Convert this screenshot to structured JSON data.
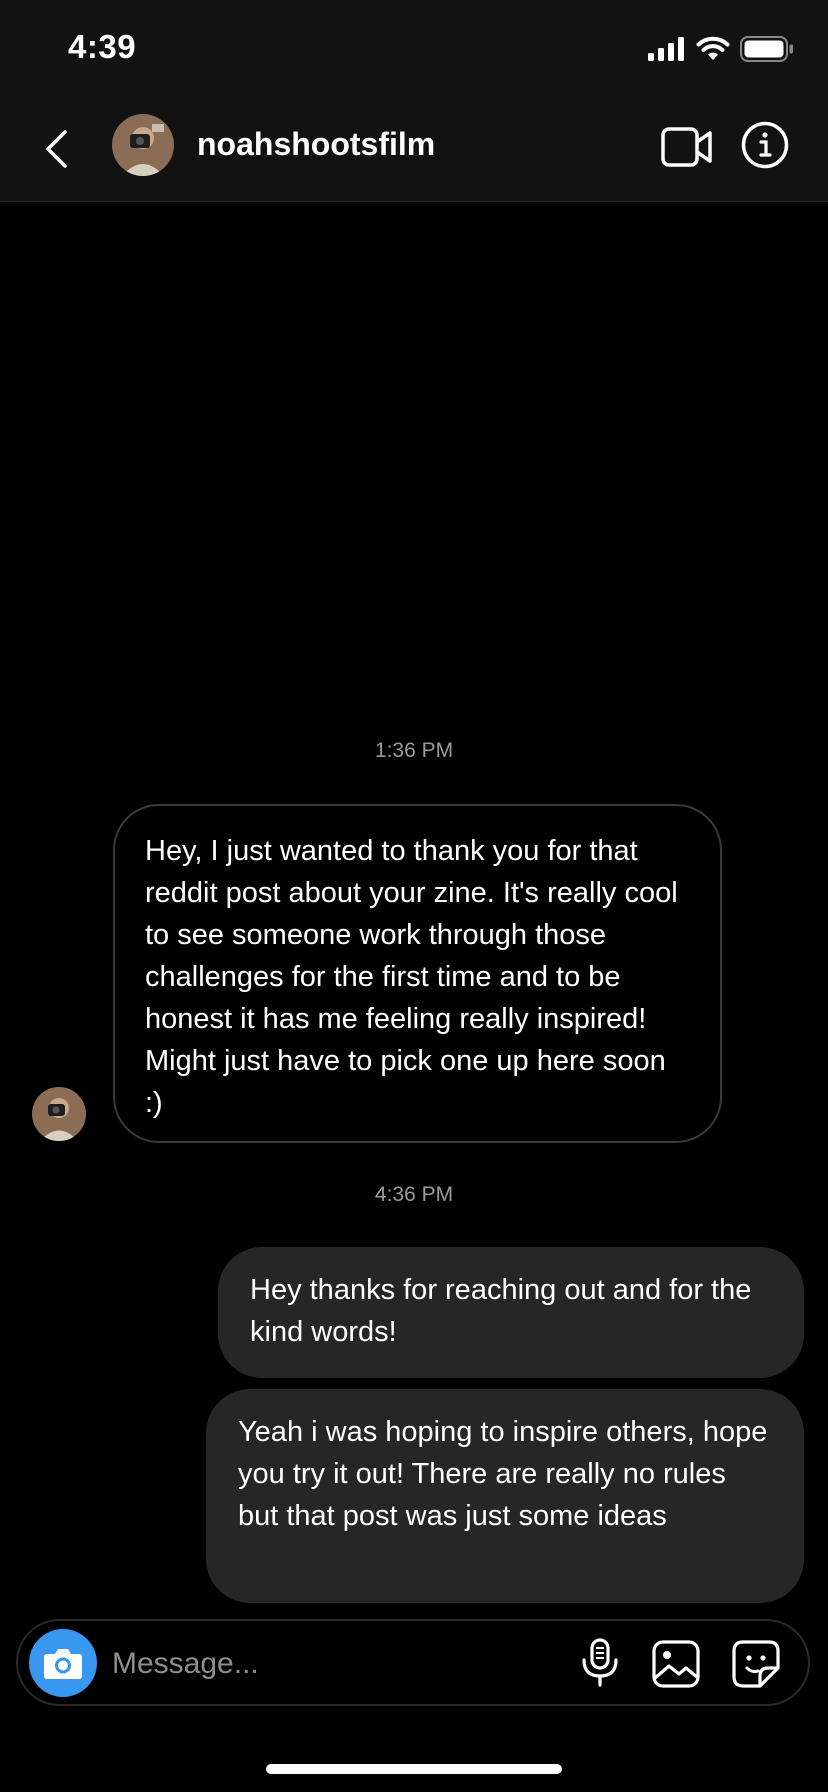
{
  "status_bar": {
    "time": "4:39",
    "signal_icon": "cellular-signal-icon",
    "wifi_icon": "wifi-icon",
    "battery_icon": "battery-icon"
  },
  "header": {
    "username": "noahshootsfilm",
    "back_icon": "chevron-left-icon",
    "avatar_icon": "profile-avatar",
    "video_icon": "video-camera-icon",
    "info_icon": "info-icon"
  },
  "conversation": {
    "timestamps": [
      "1:36 PM",
      "4:36 PM"
    ],
    "messages": [
      {
        "direction": "incoming",
        "text": "Hey, I just wanted to thank you for that reddit post about your zine. It's really cool to see someone work through those challenges for the first time and to be honest it has me feeling really inspired! Might just have to pick one up here soon :)"
      },
      {
        "direction": "outgoing",
        "text": "Hey thanks for reaching out and for the kind words!"
      },
      {
        "direction": "outgoing",
        "text": "Yeah i was hoping to inspire others, hope you try it out! There are really no rules but that post was just some ideas"
      }
    ]
  },
  "composer": {
    "placeholder": "Message...",
    "value": "",
    "camera_icon": "camera-icon",
    "mic_icon": "microphone-icon",
    "gallery_icon": "image-gallery-icon",
    "sticker_icon": "sticker-icon"
  },
  "colors": {
    "background": "#000000",
    "header_bg": "#121212",
    "outgoing_bubble": "#262626",
    "incoming_border": "#3a3a3a",
    "camera_button": "#3897f0",
    "timestamp_text": "#9a9a9a",
    "placeholder_text": "#8e8e8e"
  }
}
